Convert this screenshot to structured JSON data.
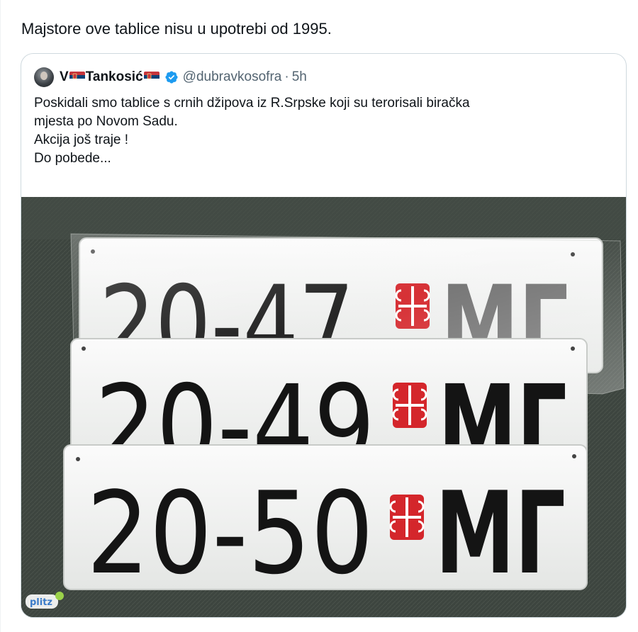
{
  "tweet": {
    "text": "Majstore ove tablice nisu u upotrebi od 1995."
  },
  "quote": {
    "author_name_prefix": "V",
    "author_name_main": "Tankosić",
    "handle": "@dubravkosofra",
    "separator": "·",
    "time": "5h",
    "lines": [
      "Poskidali smo tablice s crnih džipova iz R.Srpske koji su terorisali biračka",
      "mjesta po Novom Sadu.",
      "Akcija još traje !",
      "Do pobede..."
    ],
    "verified_color": "#1d9bf0"
  },
  "media": {
    "plates": [
      {
        "number": "20-47",
        "letters": "МГ"
      },
      {
        "number": "20-49",
        "letters": "МГ"
      },
      {
        "number": "20-50",
        "letters": "МГ"
      }
    ],
    "watermark": "plitz",
    "colors": {
      "background": "#3e4540",
      "plate": "#f2f3f2",
      "plate_text": "#141414",
      "emblem_red": "#d4262b"
    }
  },
  "icons": [
    "verified-badge-icon",
    "serbia-flag-icon",
    "serbian-cross-emblem-icon"
  ]
}
